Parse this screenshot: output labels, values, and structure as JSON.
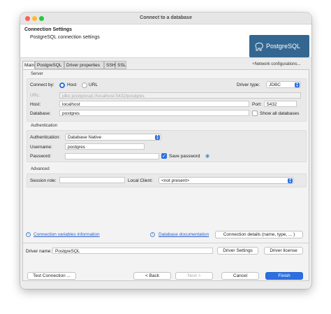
{
  "window": {
    "title": "Connect to a database"
  },
  "header": {
    "title": "Connection Settings",
    "subtitle": "PostgreSQL connection settings",
    "logo_text": "PostgreSQL"
  },
  "tabs": [
    {
      "label": "Main"
    },
    {
      "label": "PostgreSQL"
    },
    {
      "label": "Driver properties"
    },
    {
      "label": "SSH"
    },
    {
      "label": "SSL"
    }
  ],
  "network_config_label": "Network configurations...",
  "server": {
    "section_label": "Server",
    "connect_by_label": "Connect by:",
    "host_option": "Host",
    "url_option": "URL",
    "driver_type_label": "Driver type:",
    "driver_type_value": "JDBC",
    "url_label": "URL:",
    "url_value": "jdbc:postgresql://localhost:5432/postgres",
    "host_label": "Host:",
    "host_value": "localhost",
    "port_label": "Port:",
    "port_value": "5432",
    "database_label": "Database:",
    "database_value": "postgres",
    "show_all_label": "Show all databases"
  },
  "authentication": {
    "section_label": "Authentication",
    "auth_label": "Authentication:",
    "auth_value": "Database Native",
    "username_label": "Username:",
    "username_value": "postgres",
    "password_label": "Password:",
    "password_value": "",
    "save_password_label": "Save password"
  },
  "advanced": {
    "section_label": "Advanced",
    "session_role_label": "Session role:",
    "session_role_value": "",
    "local_client_label": "Local Client:",
    "local_client_value": "<not present>"
  },
  "links": {
    "conn_vars": "Connection variables information",
    "db_docs": "Database documentation",
    "conn_details": "Connection details (name, type, ... )"
  },
  "driver": {
    "name_label": "Driver name:",
    "name_value": "PostgreSQL",
    "settings_button": "Driver Settings",
    "license_button": "Driver license"
  },
  "footer": {
    "test_button": "Test Connection ...",
    "back_button": "< Back",
    "next_button": "Next >",
    "cancel_button": "Cancel",
    "finish_button": "Finish"
  }
}
